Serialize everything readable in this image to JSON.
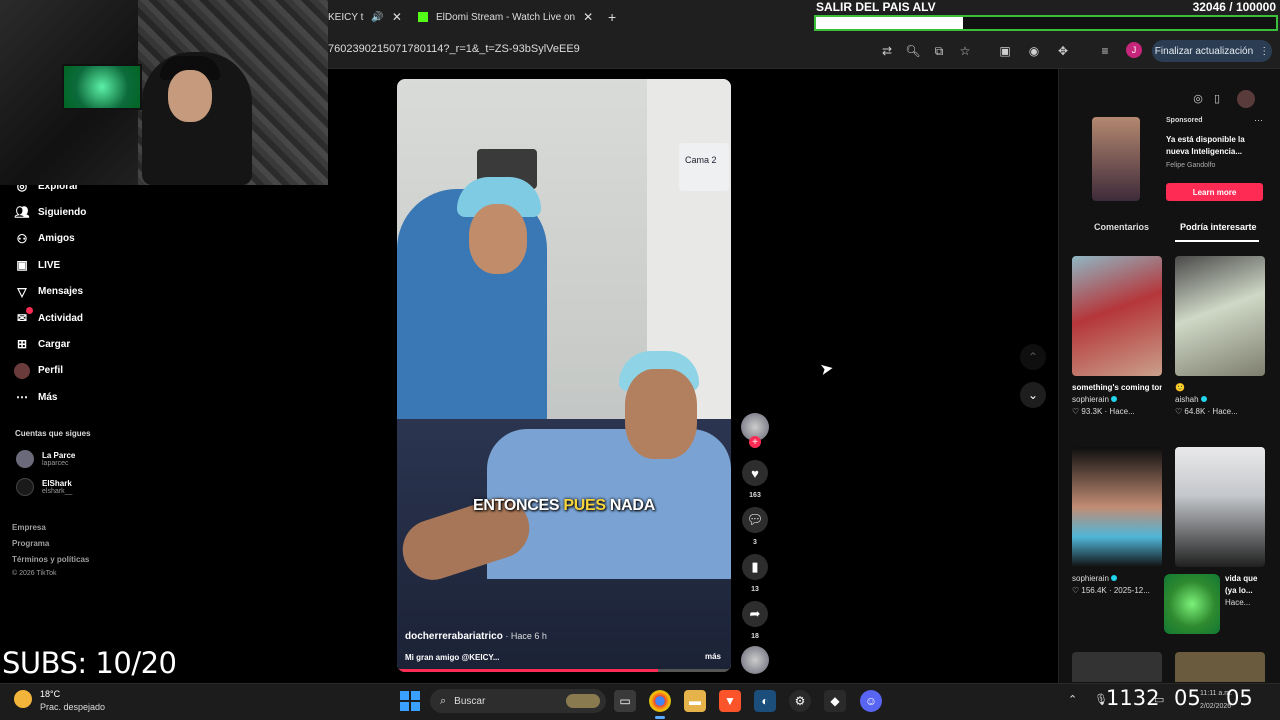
{
  "browser": {
    "tabs": [
      {
        "label": "KEICY t"
      },
      {
        "label": "ElDomi Stream - Watch Live on"
      }
    ],
    "new_tab": "+",
    "url": "76023902150717801​14?_r=1&_t=ZS-93bSylVeEE9",
    "update_button": "Finalizar actualización",
    "profile_initial": "J"
  },
  "stream_goal": {
    "title": "SALIR DEL PAIS ALV",
    "count": "32046 / 100000",
    "progress": 0.32
  },
  "subs_counter": "SUBS: 10/20",
  "sidebar": {
    "items": [
      {
        "label": "Explorar",
        "icon": "compass-icon"
      },
      {
        "label": "Siguiendo",
        "icon": "following-icon"
      },
      {
        "label": "Amigos",
        "icon": "friends-icon"
      },
      {
        "label": "LIVE",
        "icon": "live-icon"
      },
      {
        "label": "Mensajes",
        "icon": "messages-icon"
      },
      {
        "label": "Actividad",
        "icon": "activity-icon"
      },
      {
        "label": "Cargar",
        "icon": "upload-icon"
      },
      {
        "label": "Perfil",
        "icon": "profile-icon"
      },
      {
        "label": "Más",
        "icon": "more-icon"
      }
    ],
    "following_label": "Cuentas que sigues",
    "accounts": [
      {
        "name": "La Parce",
        "handle": "laparcec"
      },
      {
        "name": "ElShark",
        "handle": "elshark__"
      }
    ],
    "footer": [
      "Empresa",
      "Programa",
      "Términos y políticas"
    ],
    "copyright": "© 2026 TikTok"
  },
  "video": {
    "room_sign_text": "Cama 2",
    "caption_pre": "ENTONCES ",
    "caption_highlight": "PUES",
    "caption_post": " NADA",
    "author": "docherrerabariatrico",
    "time": " · Hace 6 h",
    "description": "Mi gran amigo @KEICY...",
    "more": "más",
    "progress": 0.78
  },
  "actions": {
    "likes": "163",
    "comments": "3",
    "saves": "13",
    "shares": "18"
  },
  "ad": {
    "sponsored": "Sponsored",
    "title": "Ya está disponible la nueva Inteligencia...",
    "author": "Felipe Gandolfo",
    "cta": "Learn more"
  },
  "panel_tabs": {
    "comments": "Comentarios",
    "interesting": "Podría interesarte"
  },
  "recommendations": [
    {
      "title": "something's coming tonight ...",
      "author": "sophierain",
      "meta": "♡ 93.3K · Hace..."
    },
    {
      "title": "🙂",
      "author": "aishah",
      "meta": "♡ 64.8K · Hace..."
    },
    {
      "title": "",
      "author": "sophierain",
      "meta": "♡ 156.4K · 2025-12..."
    },
    {
      "title": "vida que (ya lo...",
      "author": "",
      "meta": "Hace..."
    }
  ],
  "taskbar": {
    "temp": "18°C",
    "weather": "Prac. despejado",
    "search": "Buscar",
    "clock_a": "1132",
    "clock_b": "05",
    "clock_c": "05",
    "time_small": "11:11 a.m.",
    "date_small": "2/02/2026"
  },
  "colors": {
    "tiktok_red": "#fe2c55",
    "goal_border": "#3bbf3b",
    "verified": "#20d5ec"
  }
}
